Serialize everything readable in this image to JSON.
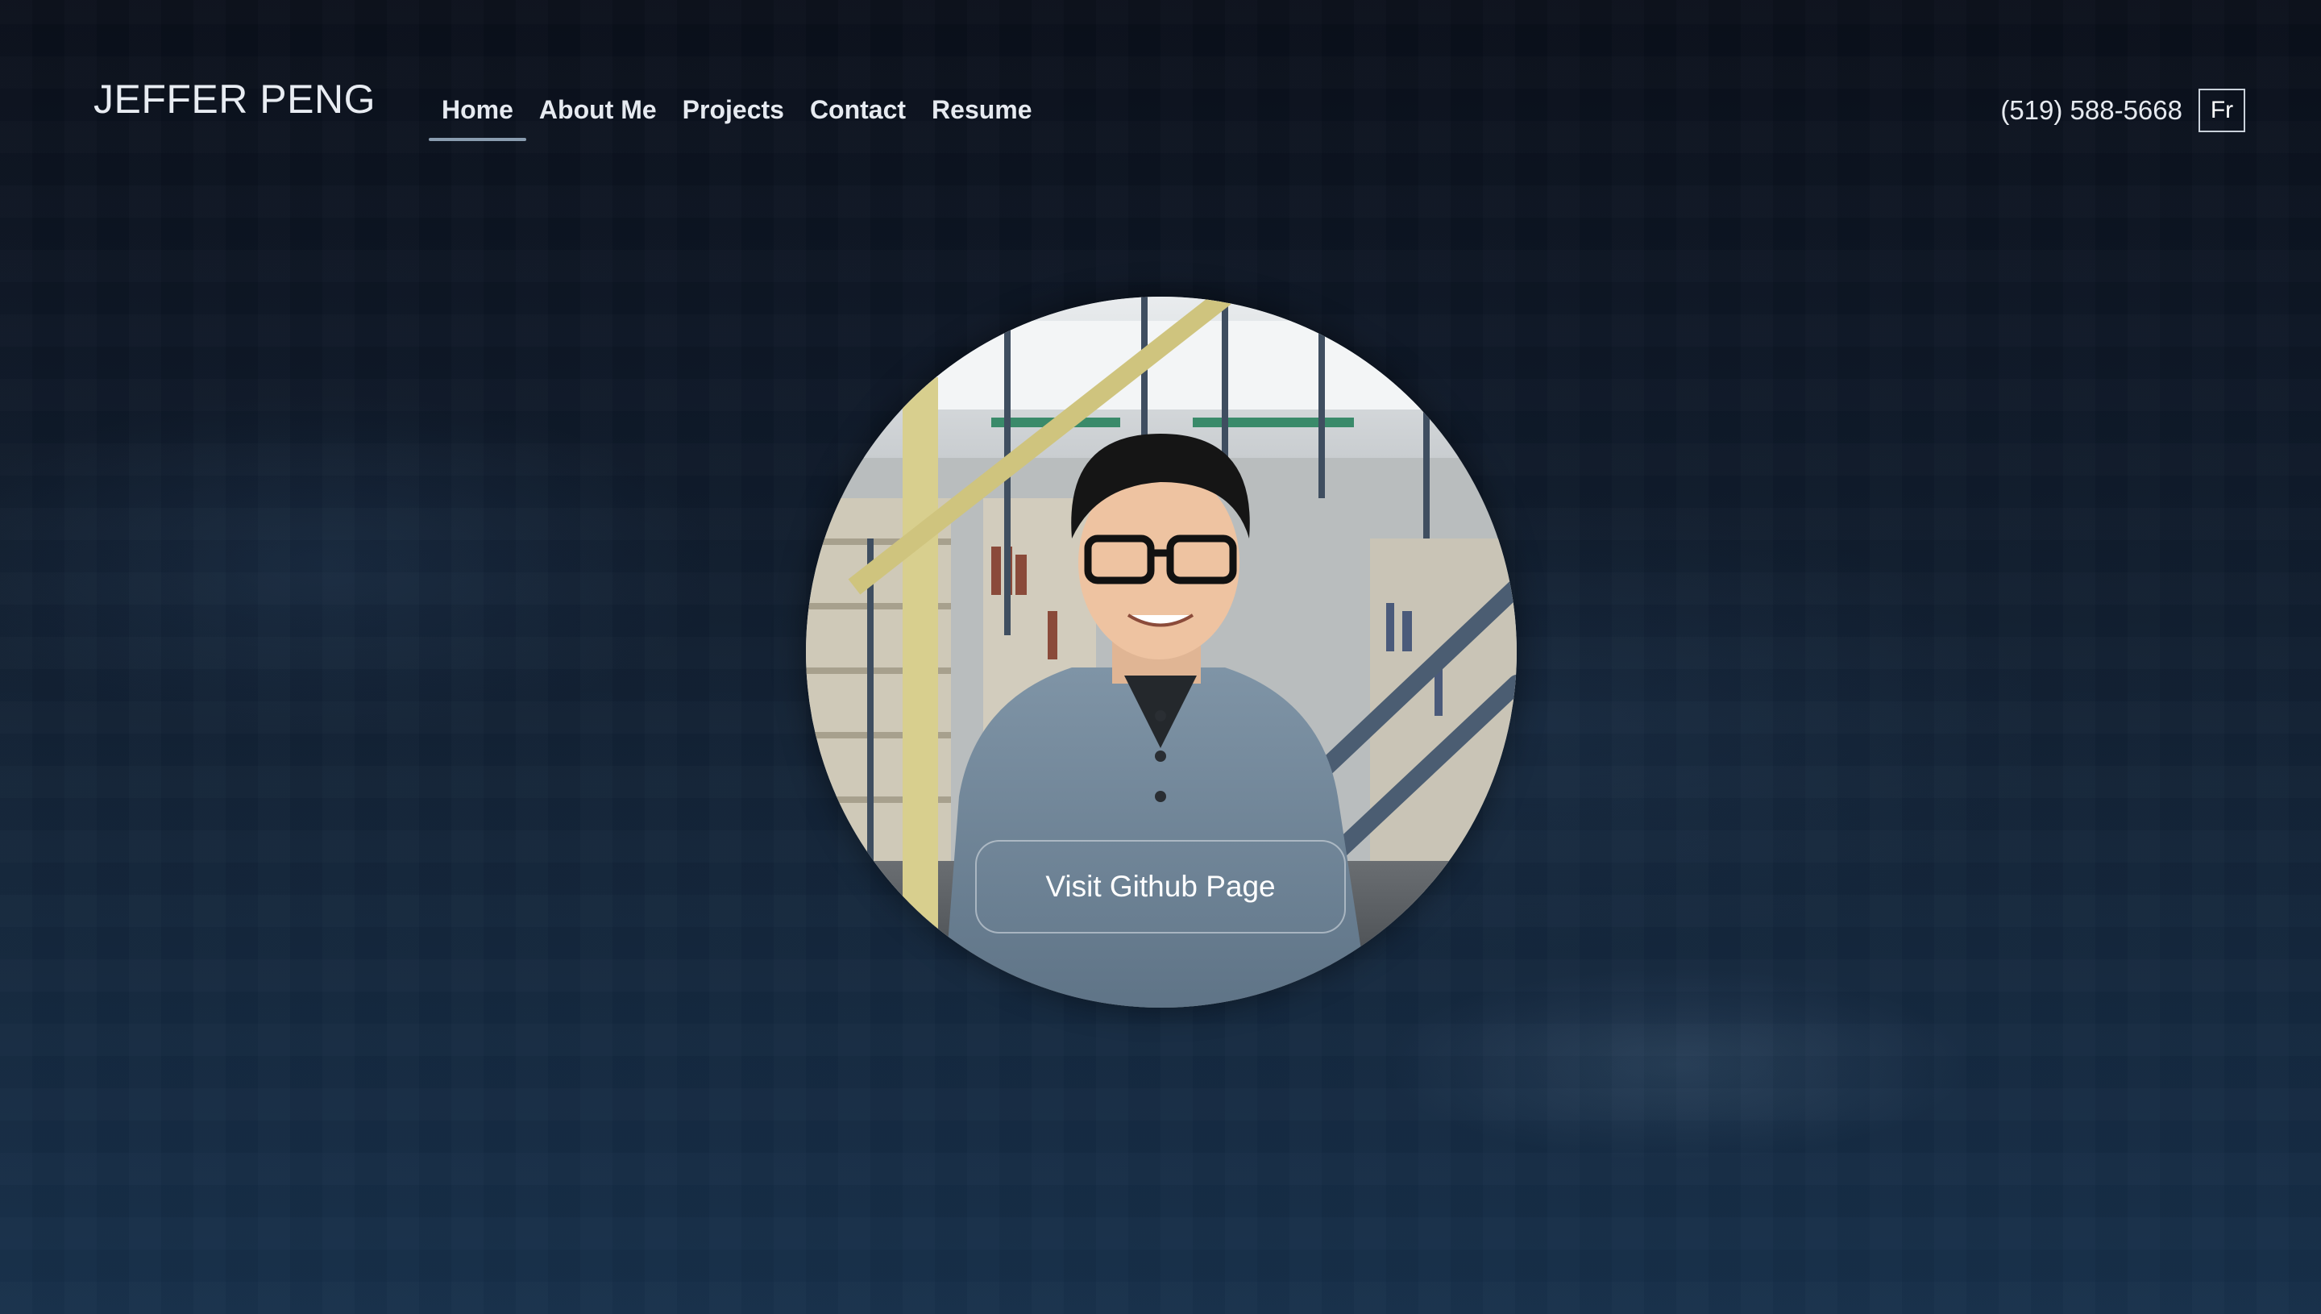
{
  "header": {
    "logo": "JEFFER PENG",
    "nav": [
      {
        "label": "Home",
        "active": true
      },
      {
        "label": "About Me",
        "active": false
      },
      {
        "label": "Projects",
        "active": false
      },
      {
        "label": "Contact",
        "active": false
      },
      {
        "label": "Resume",
        "active": false
      }
    ],
    "phone": "(519) 588-5668",
    "language_toggle": "Fr"
  },
  "hero": {
    "github_button": "Visit Github Page"
  },
  "colors": {
    "background_top": "#0a0f1a",
    "background_bottom": "#16304a",
    "text": "#e6eaf0",
    "active_underline": "#8a9db0"
  }
}
